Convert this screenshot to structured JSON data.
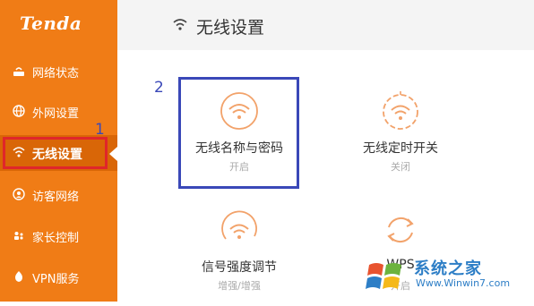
{
  "brand": {
    "logo": "Tenda"
  },
  "sidebar": {
    "items": [
      {
        "label": "网络状态",
        "icon": "network-status-icon"
      },
      {
        "label": "外网设置",
        "icon": "globe-icon"
      },
      {
        "label": "无线设置",
        "icon": "wifi-icon",
        "active": true
      },
      {
        "label": "访客网络",
        "icon": "guest-icon"
      },
      {
        "label": "家长控制",
        "icon": "parental-control-icon"
      },
      {
        "label": "VPN服务",
        "icon": "vpn-icon"
      }
    ]
  },
  "header": {
    "title": "无线设置",
    "icon": "wifi-icon"
  },
  "annotations": {
    "one": "1",
    "two": "2"
  },
  "cards": [
    {
      "name": "无线名称与密码",
      "status": "开启",
      "icon": "wifi-icon"
    },
    {
      "name": "无线定时开关",
      "status": "关闭",
      "icon": "wifi-timer-icon"
    },
    {
      "name": "信号强度调节",
      "status": "增强/增强",
      "icon": "wifi-signal-icon"
    },
    {
      "name": "WPS",
      "status": "开启",
      "icon": "refresh-icon"
    }
  ],
  "watermark": {
    "text": "系统之家",
    "url": "Www.Winwin7.com"
  },
  "colors": {
    "sidebar": "#f07c16",
    "sidebar_active": "#d96607",
    "accent_icon": "#f2a26a",
    "annotation_blue": "#3a48b8",
    "annotation_red": "#e0262a"
  }
}
